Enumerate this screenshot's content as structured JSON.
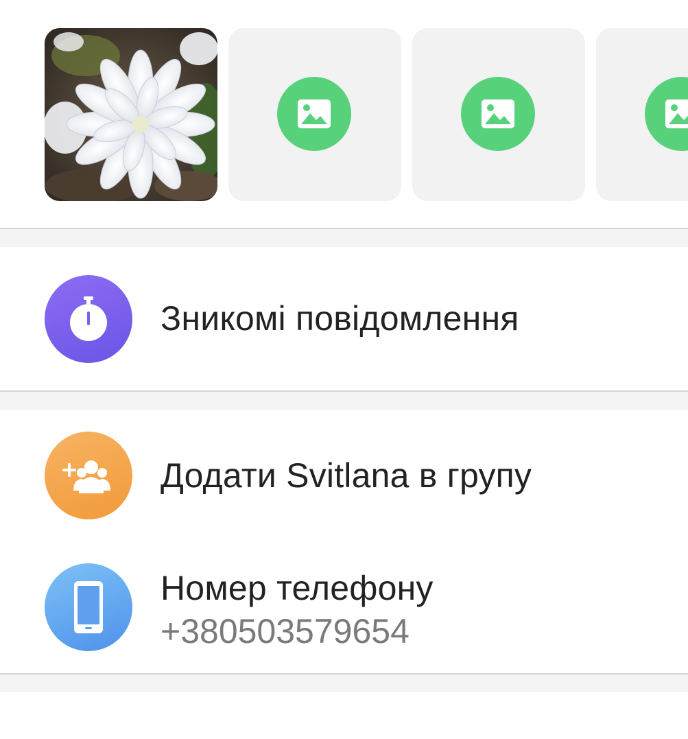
{
  "media": {
    "items": [
      {
        "kind": "photo",
        "icon": "flower-photo"
      },
      {
        "kind": "placeholder",
        "icon": "image-icon"
      },
      {
        "kind": "placeholder",
        "icon": "image-icon"
      },
      {
        "kind": "placeholder",
        "icon": "image-icon"
      }
    ],
    "placeholder_color": "#58d17b"
  },
  "settings": {
    "disappearing": {
      "label": "Зникомі повідомлення",
      "icon": "stopwatch-icon",
      "color": "#7b60ee"
    },
    "add_to_group": {
      "label": "Додати Svitlana в групу",
      "icon": "add-group-icon",
      "color": "#f4a448"
    },
    "phone": {
      "label": "Номер телефону",
      "value": "+380503579654",
      "icon": "phone-icon",
      "color": "#62a7f0"
    }
  }
}
